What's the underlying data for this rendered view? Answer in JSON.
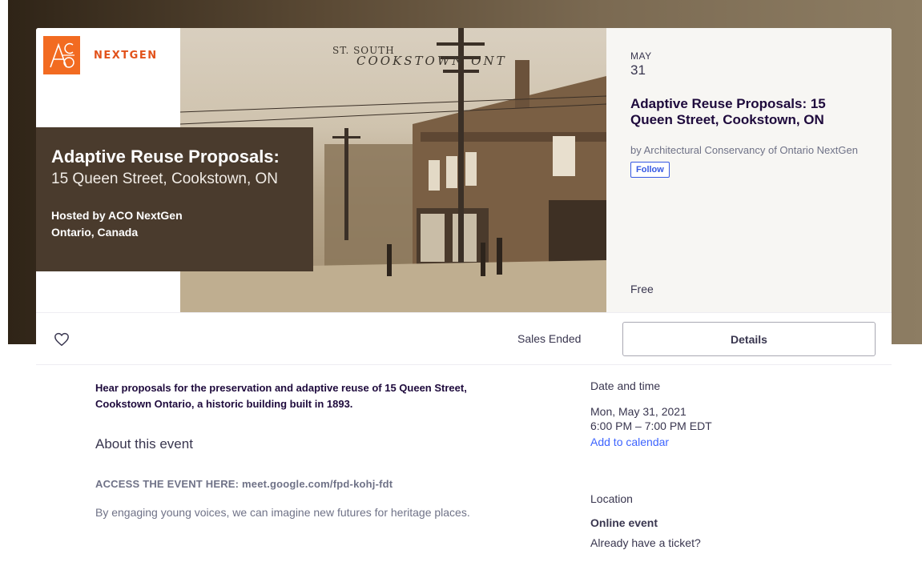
{
  "brand": {
    "logo_text": "NEXTGEN"
  },
  "hero": {
    "photo_caption_line1": "ST. SOUTH",
    "photo_caption_line2": "COOKSTOWN ONT",
    "title_bold": "Adaptive Reuse Proposals:",
    "title_light": "15 Queen Street, Cookstown, ON",
    "host_line1": "Hosted by ACO NextGen",
    "host_line2": "Ontario, Canada"
  },
  "event_panel": {
    "month": "MAY",
    "day": "31",
    "title": "Adaptive Reuse Proposals: 15 Queen Street, Cookstown, ON",
    "organizer": "by Architectural Conservancy of Ontario NextGen",
    "follow_label": "Follow",
    "price": "Free"
  },
  "action_bar": {
    "heart_icon": "heart-outline-icon",
    "status": "Sales Ended",
    "details_label": "Details"
  },
  "content": {
    "summary": "Hear proposals for the preservation and adaptive reuse of 15 Queen Street, Cookstown Ontario, a historic building built in 1893.",
    "about_heading": "About this event",
    "access_line": "ACCESS THE EVENT HERE: meet.google.com/fpd-kohj-fdt",
    "description": "By engaging young voices, we can imagine new futures for heritage places."
  },
  "sidebar": {
    "date_heading": "Date and time",
    "date_line": "Mon, May 31, 2021",
    "time_line": "6:00 PM – 7:00 PM EDT",
    "calendar_link": "Add to calendar",
    "location_heading": "Location",
    "location_value": "Online event",
    "ticket_prompt": "Already have a ticket?"
  },
  "colors": {
    "brand_orange": "#f26b21",
    "title_box": "#4a3b2d",
    "link_blue": "#3d64ff",
    "follow_blue": "#3659e3"
  }
}
